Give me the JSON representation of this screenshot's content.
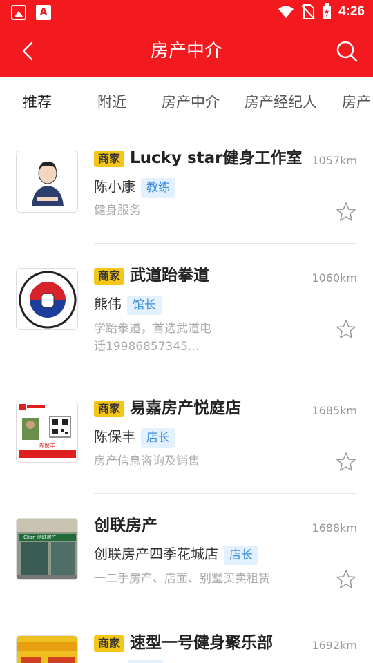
{
  "status_bar": {
    "time": "4:26"
  },
  "header": {
    "title": "房产中介"
  },
  "tabs": [
    {
      "label": "推荐"
    },
    {
      "label": "附近"
    },
    {
      "label": "房产中介"
    },
    {
      "label": "房产经纪人"
    },
    {
      "label": "房产"
    }
  ],
  "list": [
    {
      "merchant_tag": "商家",
      "name": "Lucky star健身工作室",
      "distance": "1057km",
      "person": "陈小康",
      "role": "教练",
      "desc": "健身服务",
      "thumb_icon": "avatar-cartoon-icon"
    },
    {
      "merchant_tag": "商家",
      "name": "武道跆拳道",
      "distance": "1060km",
      "person": "熊伟",
      "role": "馆长",
      "desc": "学跆拳道，首选武道电话19986857345...",
      "thumb_icon": "taekwondo-logo"
    },
    {
      "merchant_tag": "商家",
      "name": "易嘉房产悦庭店",
      "distance": "1685km",
      "person": "陈保丰",
      "role": "店长",
      "desc": "房产信息咨询及销售",
      "thumb_icon": "business-card-image",
      "card_name": "陈保丰"
    },
    {
      "merchant_tag": "",
      "name": "创联房产",
      "distance": "1688km",
      "person": "创联房产四季花城店",
      "role": "店长",
      "desc": "一二手房产、店面、别墅买卖租赁",
      "thumb_icon": "storefront-photo",
      "store_sign": "Clian 创联房产"
    },
    {
      "merchant_tag": "商家",
      "name": "速型一号健身聚乐部",
      "distance": "1692km",
      "person": "",
      "role": "",
      "desc": "",
      "thumb_icon": "gym-banner-image"
    }
  ],
  "colors": {
    "primary": "#f21a1f",
    "merchant_tag": "#f5c518",
    "role_badge_bg": "#e3f0fd",
    "role_badge_text": "#3b8de0"
  }
}
